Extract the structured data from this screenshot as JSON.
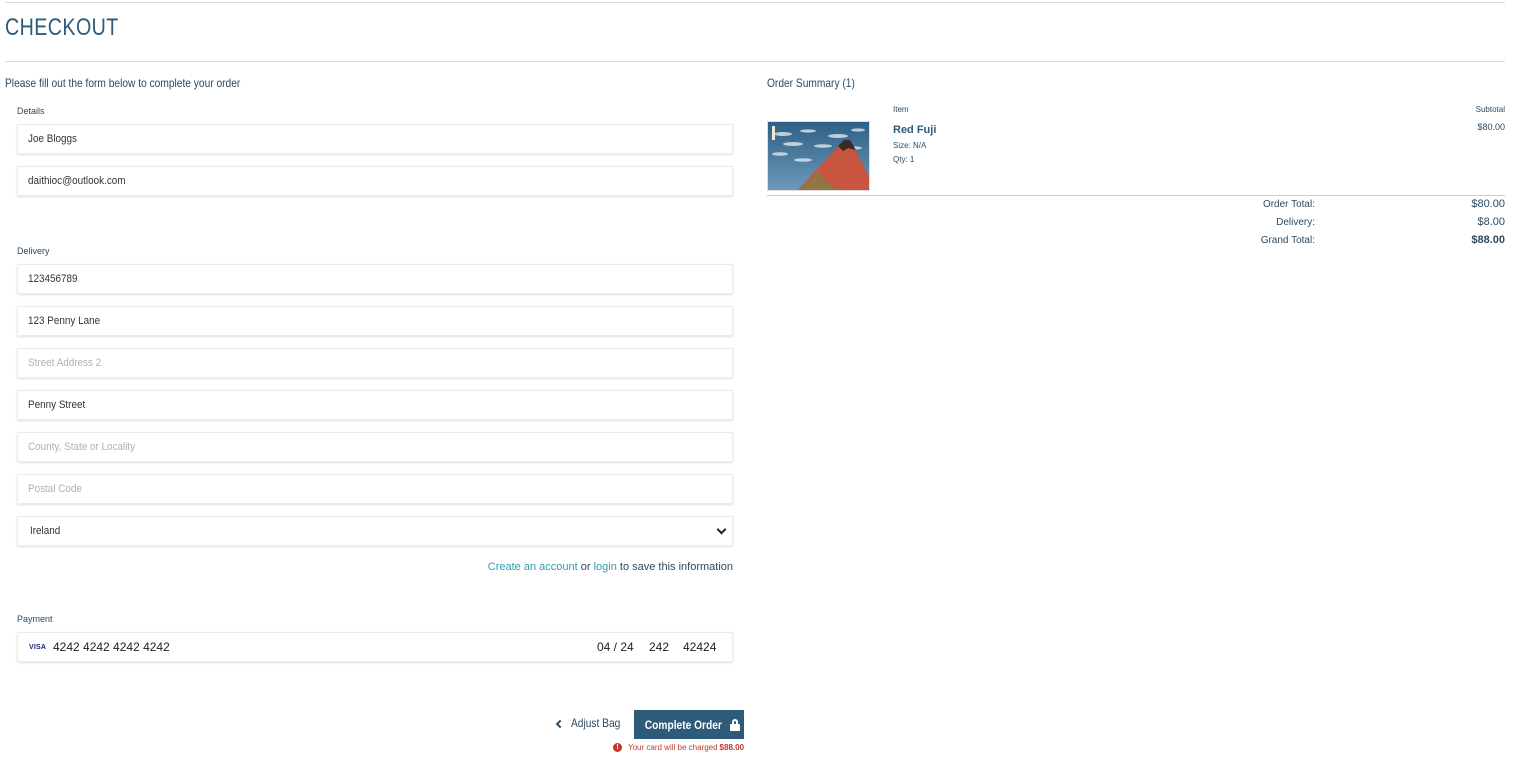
{
  "page": {
    "title": "CHECKOUT",
    "intro": "Please fill out the form below to complete your order"
  },
  "details": {
    "label": "Details",
    "full_name": "Joe Bloggs",
    "email": "daithioc@outlook.com"
  },
  "delivery": {
    "label": "Delivery",
    "phone": "123456789",
    "street1": "123 Penny Lane",
    "street2_placeholder": "Street Address 2",
    "town": "Penny Street",
    "county_placeholder": "County, State or Locality",
    "postcode_placeholder": "Postal Code",
    "country": "Ireland"
  },
  "account": {
    "create_link": "Create an account",
    "or_text": " or ",
    "login_link": "login",
    "suffix": " to save this information"
  },
  "payment": {
    "label": "Payment",
    "brand": "VISA",
    "card_number": "4242 4242 4242 4242",
    "expiry": "04 / 24",
    "cvc": "242",
    "zip": "42424"
  },
  "actions": {
    "adjust_bag": "Adjust Bag",
    "complete_order": "Complete Order",
    "charge_note": "Your card will be charged",
    "charge_amount": "$88.00"
  },
  "summary": {
    "title": "Order Summary (1)",
    "col_item": "Item",
    "col_subtotal": "Subtotal",
    "item": {
      "name": "Red Fuji",
      "size": "Size: N/A",
      "qty": "Qty: 1",
      "subtotal": "$80.00"
    },
    "order_total_label": "Order Total:",
    "order_total": "$80.00",
    "delivery_label": "Delivery:",
    "delivery": "$8.00",
    "grand_total_label": "Grand Total:",
    "grand_total": "$88.00"
  },
  "colors": {
    "primary": "#2f5b7a",
    "link": "#2ba0b0",
    "error": "#c0392b"
  }
}
